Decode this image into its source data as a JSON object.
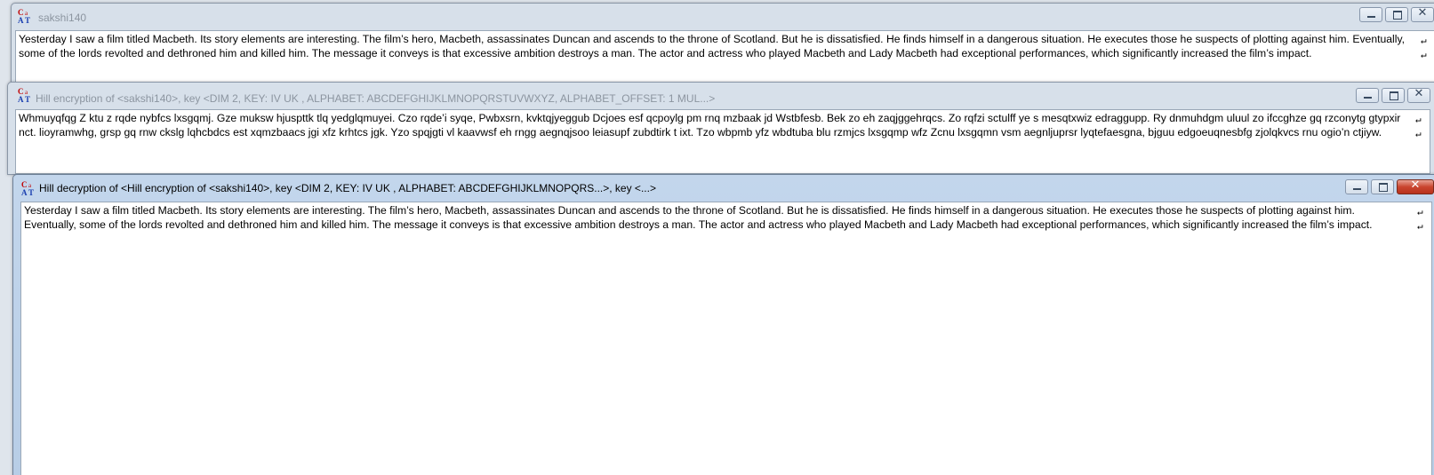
{
  "windows": [
    {
      "title": "sakshi140",
      "text": "Yesterday I saw a film titled Macbeth. Its story elements are interesting. The film’s hero, Macbeth, assassinates Duncan and ascends to the throne of Scotland. But he is dissatisfied. He finds himself in a dangerous situation. He executes those he suspects of plotting against him. Eventually, some of the lords revolted and dethroned him and killed him. The message it conveys is that excessive ambition destroys a man. The actor and actress who played Macbeth and Lady Macbeth had exceptional performances, which significantly increased the film’s impact."
    },
    {
      "title": "Hill encryption of <sakshi140>, key <DIM 2, KEY: IV UK , ALPHABET: ABCDEFGHIJKLMNOPQRSTUVWXYZ, ALPHABET_OFFSET: 1 MUL...>",
      "text": "Whmuyqfqg Z ktu z rqde nybfcs lxsgqmj. Gze muksw hjuspttk tlq yedglqmuyei. Czo rqde’i syqe, Pwbxsrn, kvktqjyeggub Dcjoes esf qcpoylg pm rnq mzbaak jd Wstbfesb. Bek zo eh zaqjggehrqcs. Zo rqfzi sctulff ye s mesqtxwiz edraggupp. Ry dnmuhdgm uluul zo ifccghze gq rzconytg gtypxir nct. lioyramwhg, grsp gq rnw ckslg lqhcbdcs est xqmzbaacs jgi xfz krhtcs jgk. Yzo spqjgti vl kaavwsf eh rngg aegnqjsoo leiasupf zubdtirk t ixt. Tzo wbpmb yfz wbdtuba blu rzmjcs lxsgqmp wfz Zcnu lxsgqmn vsm aegnljuprsr lyqtefaesgna, bjguu edgoeuqnesbfg zjolqkvcs rnu ogio’n ctjiyw."
    },
    {
      "title": "Hill decryption of <Hill encryption of <sakshi140>, key <DIM 2, KEY: IV UK , ALPHABET: ABCDEFGHIJKLMNOPQRS...>, key <...>",
      "text": "Yesterday I saw a film titled Macbeth. Its story elements are interesting. The film’s hero, Macbeth, assassinates Duncan and ascends to the throne of Scotland. But he is dissatisfied. He finds himself in a dangerous situation. He executes those he suspects of plotting against him. Eventually, some of the lords revolted and dethroned him and killed him. The message it conveys is that excessive ambition destroys a man. The actor and actress who played Macbeth and Lady Macbeth had exceptional performances, which significantly increased the film’s impact."
    }
  ],
  "icons": {
    "app": "cat-app-icon",
    "minimize": "minimize-icon",
    "maximize": "maximize-icon",
    "close": "close-icon",
    "wrap": "line-wrap-marker-icon"
  },
  "colors": {
    "close_active": "#c9452f",
    "title_inactive": "#8c95a0"
  }
}
